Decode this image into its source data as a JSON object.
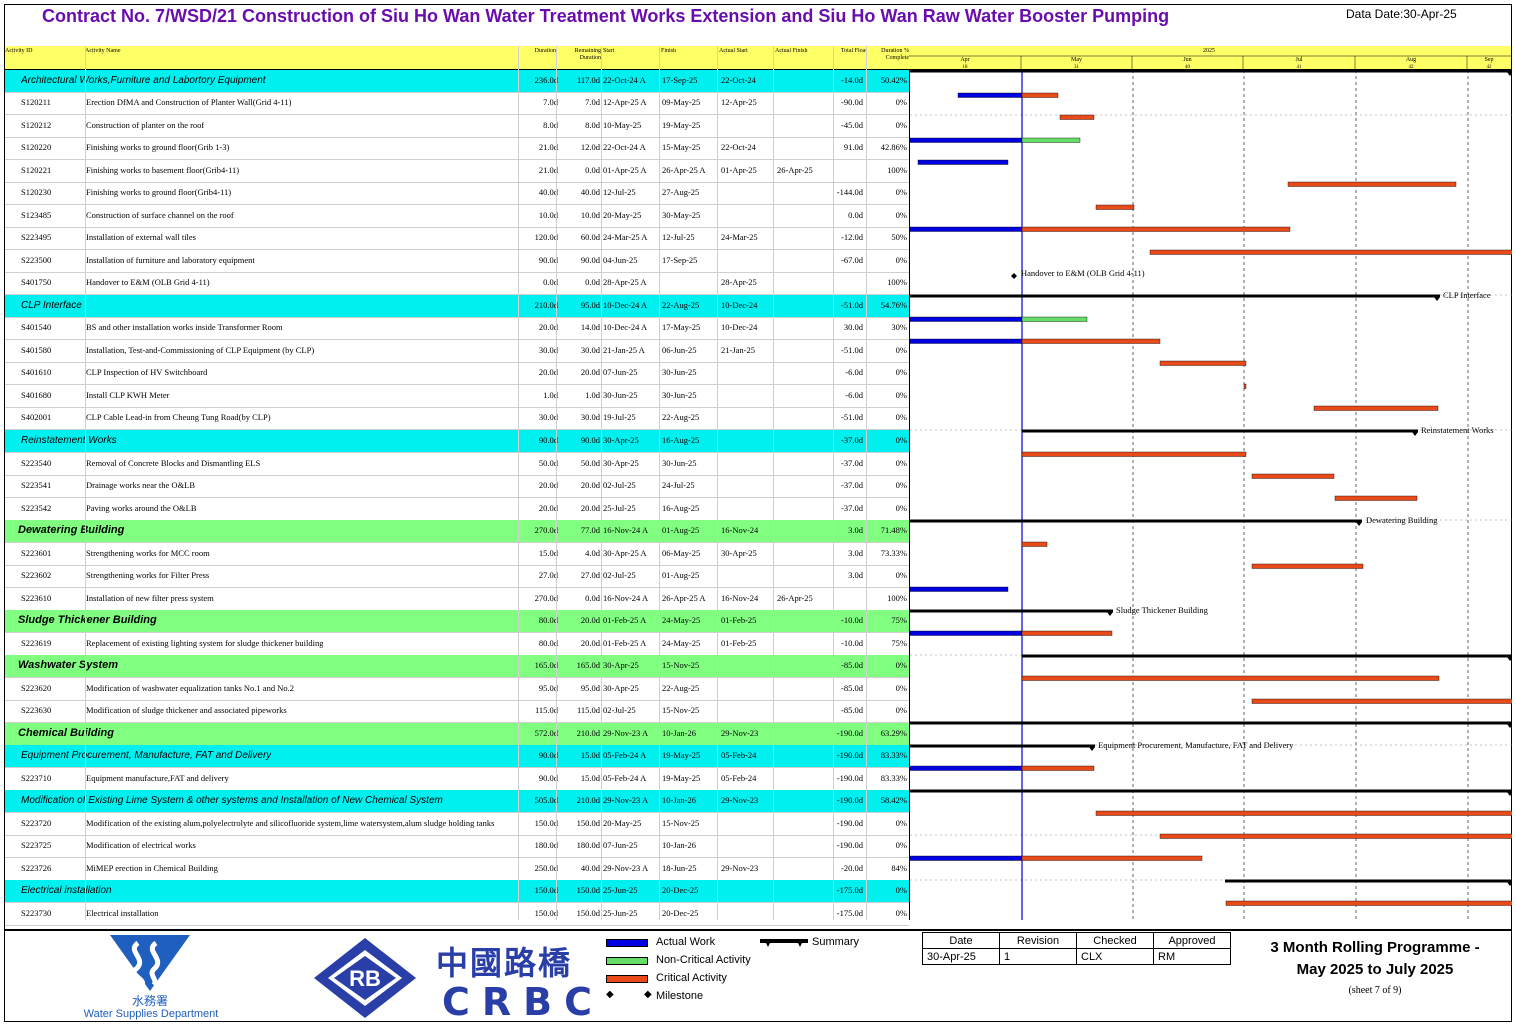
{
  "title": "Contract No. 7/WSD/21 Construction of Siu Ho Wan Water Treatment Works Extension and Siu Ho Wan Raw Water Booster Pumping",
  "data_date": "Data Date:30-Apr-25",
  "headers": [
    "Activity ID",
    "Activity Name",
    "Duration",
    "Remaining Duration",
    "Start",
    "Finish",
    "Actual Start",
    "Actual Finish",
    "Total Float",
    "Duration % Complete"
  ],
  "timeline": {
    "year": "2025",
    "months": [
      {
        "m": "Apr",
        "w": "18"
      },
      {
        "m": "May",
        "w": "31"
      },
      {
        "m": "Jun",
        "w": "40"
      },
      {
        "m": "Jul",
        "w": "41"
      },
      {
        "m": "Aug",
        "w": "42"
      },
      {
        "m": "Sep",
        "w": "42"
      }
    ]
  },
  "rows": [
    {
      "kind": "cyan",
      "name": "Architectural Works,Furniture and Labortory Equipment",
      "dur": "236.0d",
      "rem": "117.0d",
      "start": "22-Oct-24 A",
      "finish": "17-Sep-25",
      "as": "22-Oct-24",
      "af": "",
      "tf": "-14.0d",
      "pct": "50.42%"
    },
    {
      "kind": "task",
      "id": "S120211",
      "name": "Erection DfMA and Construction of Planter Wall(Grid 4-11)",
      "dur": "7.0d",
      "rem": "7.0d",
      "start": "12-Apr-25 A",
      "finish": "09-May-25",
      "as": "12-Apr-25",
      "af": "",
      "tf": "-90.0d",
      "pct": "0%"
    },
    {
      "kind": "task",
      "id": "S120212",
      "name": "Construction of planter on the roof",
      "dur": "8.0d",
      "rem": "8.0d",
      "start": "10-May-25",
      "finish": "19-May-25",
      "as": "",
      "af": "",
      "tf": "-45.0d",
      "pct": "0%"
    },
    {
      "kind": "task",
      "id": "S120220",
      "name": "Finishing works to ground floor(Grib 1-3)",
      "dur": "21.0d",
      "rem": "12.0d",
      "start": "22-Oct-24 A",
      "finish": "15-May-25",
      "as": "22-Oct-24",
      "af": "",
      "tf": "91.0d",
      "pct": "42.86%"
    },
    {
      "kind": "task",
      "id": "S120221",
      "name": "Finishing works to basement floor(Grib4-11)",
      "dur": "21.0d",
      "rem": "0.0d",
      "start": "01-Apr-25 A",
      "finish": "26-Apr-25 A",
      "as": "01-Apr-25",
      "af": "26-Apr-25",
      "tf": "",
      "pct": "100%"
    },
    {
      "kind": "task",
      "id": "S120230",
      "name": "Finishing works to ground floor(Grib4-11)",
      "dur": "40.0d",
      "rem": "40.0d",
      "start": "12-Jul-25",
      "finish": "27-Aug-25",
      "as": "",
      "af": "",
      "tf": "-144.0d",
      "pct": "0%"
    },
    {
      "kind": "task",
      "id": "S123485",
      "name": "Construction of surface channel on the roof",
      "dur": "10.0d",
      "rem": "10.0d",
      "start": "20-May-25",
      "finish": "30-May-25",
      "as": "",
      "af": "",
      "tf": "0.0d",
      "pct": "0%"
    },
    {
      "kind": "task",
      "id": "S223495",
      "name": "Installation of external wall tiles",
      "dur": "120.0d",
      "rem": "60.0d",
      "start": "24-Mar-25 A",
      "finish": "12-Jul-25",
      "as": "24-Mar-25",
      "af": "",
      "tf": "-12.0d",
      "pct": "50%"
    },
    {
      "kind": "task",
      "id": "S223500",
      "name": "Installation of furniture and laboratory equipment",
      "dur": "90.0d",
      "rem": "90.0d",
      "start": "04-Jun-25",
      "finish": "17-Sep-25",
      "as": "",
      "af": "",
      "tf": "-67.0d",
      "pct": "0%"
    },
    {
      "kind": "task",
      "id": "S401750",
      "name": "Handover to E&M (OLB Grid 4-11)",
      "dur": "0.0d",
      "rem": "0.0d",
      "start": "28-Apr-25 A",
      "finish": "",
      "as": "28-Apr-25",
      "af": "",
      "tf": "",
      "pct": "100%"
    },
    {
      "kind": "cyan",
      "name": "CLP Interface",
      "dur": "210.0d",
      "rem": "95.0d",
      "start": "10-Dec-24 A",
      "finish": "22-Aug-25",
      "as": "10-Dec-24",
      "af": "",
      "tf": "-51.0d",
      "pct": "54.76%"
    },
    {
      "kind": "task",
      "id": "S401540",
      "name": "BS and other installation works inside Transformer Room",
      "dur": "20.0d",
      "rem": "14.0d",
      "start": "10-Dec-24 A",
      "finish": "17-May-25",
      "as": "10-Dec-24",
      "af": "",
      "tf": "30.0d",
      "pct": "30%"
    },
    {
      "kind": "task",
      "id": "S401580",
      "name": "Installation, Test-and-Commissioning of CLP Equipment (by CLP)",
      "dur": "30.0d",
      "rem": "30.0d",
      "start": "21-Jan-25 A",
      "finish": "06-Jun-25",
      "as": "21-Jan-25",
      "af": "",
      "tf": "-51.0d",
      "pct": "0%"
    },
    {
      "kind": "task",
      "id": "S401610",
      "name": "CLP Inspection of HV Switchboard",
      "dur": "20.0d",
      "rem": "20.0d",
      "start": "07-Jun-25",
      "finish": "30-Jun-25",
      "as": "",
      "af": "",
      "tf": "-6.0d",
      "pct": "0%"
    },
    {
      "kind": "task",
      "id": "S401680",
      "name": "Install CLP KWH Meter",
      "dur": "1.0d",
      "rem": "1.0d",
      "start": "30-Jun-25",
      "finish": "30-Jun-25",
      "as": "",
      "af": "",
      "tf": "-6.0d",
      "pct": "0%"
    },
    {
      "kind": "task",
      "id": "S402001",
      "name": "CLP Cable Lead-in from Cheung Tung Road(by CLP)",
      "dur": "30.0d",
      "rem": "30.0d",
      "start": "19-Jul-25",
      "finish": "22-Aug-25",
      "as": "",
      "af": "",
      "tf": "-51.0d",
      "pct": "0%"
    },
    {
      "kind": "cyan",
      "name": "Reinstatement Works",
      "dur": "90.0d",
      "rem": "90.0d",
      "start": "30-Apr-25",
      "finish": "16-Aug-25",
      "as": "",
      "af": "",
      "tf": "-37.0d",
      "pct": "0%"
    },
    {
      "kind": "task",
      "id": "S223540",
      "name": "Removal of Concrete Blocks and Dismantling ELS",
      "dur": "50.0d",
      "rem": "50.0d",
      "start": "30-Apr-25",
      "finish": "30-Jun-25",
      "as": "",
      "af": "",
      "tf": "-37.0d",
      "pct": "0%"
    },
    {
      "kind": "task",
      "id": "S223541",
      "name": "Drainage works near the O&LB",
      "dur": "20.0d",
      "rem": "20.0d",
      "start": "02-Jul-25",
      "finish": "24-Jul-25",
      "as": "",
      "af": "",
      "tf": "-37.0d",
      "pct": "0%"
    },
    {
      "kind": "task",
      "id": "S223542",
      "name": "Paving works around the O&LB",
      "dur": "20.0d",
      "rem": "20.0d",
      "start": "25-Jul-25",
      "finish": "16-Aug-25",
      "as": "",
      "af": "",
      "tf": "-37.0d",
      "pct": "0%"
    },
    {
      "kind": "green",
      "name": "Dewatering Building",
      "dur": "270.0d",
      "rem": "77.0d",
      "start": "16-Nov-24 A",
      "finish": "01-Aug-25",
      "as": "16-Nov-24",
      "af": "",
      "tf": "3.0d",
      "pct": "71.48%"
    },
    {
      "kind": "task",
      "id": "S223601",
      "name": "Strengthening works for MCC room",
      "dur": "15.0d",
      "rem": "4.0d",
      "start": "30-Apr-25 A",
      "finish": "06-May-25",
      "as": "30-Apr-25",
      "af": "",
      "tf": "3.0d",
      "pct": "73.33%"
    },
    {
      "kind": "task",
      "id": "S223602",
      "name": "Strengthening works for Filter Press",
      "dur": "27.0d",
      "rem": "27.0d",
      "start": "02-Jul-25",
      "finish": "01-Aug-25",
      "as": "",
      "af": "",
      "tf": "3.0d",
      "pct": "0%"
    },
    {
      "kind": "task",
      "id": "S223610",
      "name": "Installation of new filter press system",
      "dur": "270.0d",
      "rem": "0.0d",
      "start": "16-Nov-24 A",
      "finish": "26-Apr-25 A",
      "as": "16-Nov-24",
      "af": "26-Apr-25",
      "tf": "",
      "pct": "100%"
    },
    {
      "kind": "green",
      "name": "Sludge Thickener Building",
      "dur": "80.0d",
      "rem": "20.0d",
      "start": "01-Feb-25 A",
      "finish": "24-May-25",
      "as": "01-Feb-25",
      "af": "",
      "tf": "-10.0d",
      "pct": "75%"
    },
    {
      "kind": "task",
      "id": "S223619",
      "name": "Replacement of existing lighting system for sludge thickener building",
      "dur": "80.0d",
      "rem": "20.0d",
      "start": "01-Feb-25 A",
      "finish": "24-May-25",
      "as": "01-Feb-25",
      "af": "",
      "tf": "-10.0d",
      "pct": "75%"
    },
    {
      "kind": "green",
      "name": "Washwater System",
      "dur": "165.0d",
      "rem": "165.0d",
      "start": "30-Apr-25",
      "finish": "15-Nov-25",
      "as": "",
      "af": "",
      "tf": "-85.0d",
      "pct": "0%"
    },
    {
      "kind": "task",
      "id": "S223620",
      "name": "Modification of washwater equalization tanks No.1 and No.2",
      "dur": "95.0d",
      "rem": "95.0d",
      "start": "30-Apr-25",
      "finish": "22-Aug-25",
      "as": "",
      "af": "",
      "tf": "-85.0d",
      "pct": "0%"
    },
    {
      "kind": "task",
      "id": "S223630",
      "name": "Modification of sludge thickener and associated pipeworks",
      "dur": "115.0d",
      "rem": "115.0d",
      "start": "02-Jul-25",
      "finish": "15-Nov-25",
      "as": "",
      "af": "",
      "tf": "-85.0d",
      "pct": "0%"
    },
    {
      "kind": "green",
      "name": "Chemical Building",
      "dur": "572.0d",
      "rem": "210.0d",
      "start": "29-Nov-23 A",
      "finish": "10-Jan-26",
      "as": "29-Nov-23",
      "af": "",
      "tf": "-190.0d",
      "pct": "63.29%"
    },
    {
      "kind": "cyan",
      "name": "Equipment Procurement, Manufacture, FAT and Delivery",
      "dur": "90.0d",
      "rem": "15.0d",
      "start": "05-Feb-24 A",
      "finish": "19-May-25",
      "as": "05-Feb-24",
      "af": "",
      "tf": "-190.0d",
      "pct": "83.33%"
    },
    {
      "kind": "task",
      "id": "S223710",
      "name": "Equipment manufacture,FAT and delivery",
      "dur": "90.0d",
      "rem": "15.0d",
      "start": "05-Feb-24 A",
      "finish": "19-May-25",
      "as": "05-Feb-24",
      "af": "",
      "tf": "-190.0d",
      "pct": "83.33%"
    },
    {
      "kind": "cyan",
      "name": "Modification of Existing Lime System & other systems and Installation of New Chemical System",
      "dur": "505.0d",
      "rem": "210.0d",
      "start": "29-Nov-23 A",
      "finish": "10-Jan-26",
      "as": "29-Nov-23",
      "af": "",
      "tf": "-190.0d",
      "pct": "58.42%"
    },
    {
      "kind": "task",
      "id": "S223720",
      "name": "Modification of the existing alum,polyelectrolyte and silicofluoride system,lime watersystem,alum sludge holding tanks",
      "dur": "150.0d",
      "rem": "150.0d",
      "start": "20-May-25",
      "finish": "15-Nov-25",
      "as": "",
      "af": "",
      "tf": "-190.0d",
      "pct": "0%"
    },
    {
      "kind": "task",
      "id": "S223725",
      "name": "Modification of electrical works",
      "dur": "180.0d",
      "rem": "180.0d",
      "start": "07-Jun-25",
      "finish": "10-Jan-26",
      "as": "",
      "af": "",
      "tf": "-190.0d",
      "pct": "0%"
    },
    {
      "kind": "task",
      "id": "S223726",
      "name": "MiMEP erection in Chemical Building",
      "dur": "250.0d",
      "rem": "40.0d",
      "start": "29-Nov-23 A",
      "finish": "18-Jun-25",
      "as": "29-Nov-23",
      "af": "",
      "tf": "-20.0d",
      "pct": "84%"
    },
    {
      "kind": "cyan",
      "name": "Electrical installation",
      "dur": "150.0d",
      "rem": "150.0d",
      "start": "25-Jun-25",
      "finish": "20-Dec-25",
      "as": "",
      "af": "",
      "tf": "-175.0d",
      "pct": "0%"
    },
    {
      "kind": "task",
      "id": "S223730",
      "name": "Electrical installation",
      "dur": "150.0d",
      "rem": "150.0d",
      "start": "25-Jun-25",
      "finish": "20-Dec-25",
      "as": "",
      "af": "",
      "tf": "-175.0d",
      "pct": "0%"
    }
  ],
  "gantt_labels": {
    "milestone": "Handover to E&M (OLB Grid 4-11)",
    "clp": "CLP Interface",
    "reinst": "Reinstatement Works",
    "dewater": "Dewatering Building",
    "sludge": "Sludge Thickener Building",
    "equip": "Equipment Procurement, Manufacture, FAT and Delivery"
  },
  "legend": {
    "actual": "Actual Work",
    "noncrit": "Non-Critical Activity",
    "crit": "Critical Activity",
    "milestone": "Milestone",
    "summary": "Summary"
  },
  "colors": {
    "actual": "#0000e0",
    "noncrit": "#66dd66",
    "crit": "#e84a1a",
    "cyan": "#00f0f0",
    "green": "#80ff80",
    "title": "#6a0dad"
  },
  "logo_wsd": {
    "chinese": "水務署",
    "english": "Water Supplies Department"
  },
  "logo_crbc": {
    "rb": "RB",
    "chinese": "中國路橋",
    "english": "CRBC"
  },
  "revision": {
    "headers": [
      "Date",
      "Revision",
      "Checked",
      "Approved"
    ],
    "values": [
      "30-Apr-25",
      "1",
      "CLX",
      "RM"
    ]
  },
  "programme": {
    "line1": "3 Month Rolling Programme -",
    "line2": "May 2025 to July 2025",
    "sheet": "(sheet 7 of 9)"
  }
}
